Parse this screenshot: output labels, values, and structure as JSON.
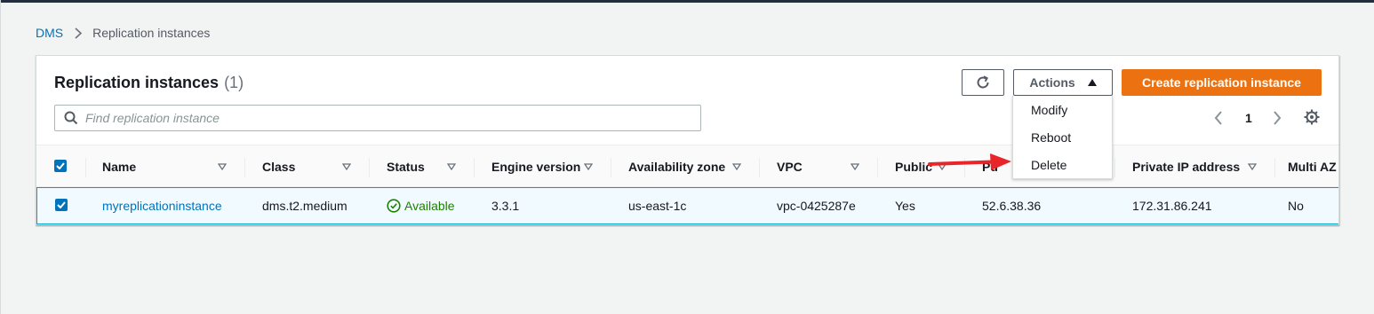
{
  "colors": {
    "link": "#0073bb",
    "primary": "#ec7211",
    "success": "#1d8102",
    "annotation_arrow": "#e8262a",
    "selected_row_bg": "#f1faff",
    "selected_row_border": "#00a1c9"
  },
  "breadcrumb": {
    "items": [
      {
        "label": "DMS",
        "link": true
      },
      {
        "label": "Replication instances",
        "link": false
      }
    ],
    "separator_icon": "chevron-right-icon"
  },
  "panel": {
    "title": "Replication instances",
    "count": "(1)",
    "search_placeholder": "Find replication instance",
    "refresh_icon": "refresh-icon",
    "actions_label": "Actions",
    "actions_icon": "caret-up-icon",
    "create_label": "Create replication instance",
    "pagination": {
      "current_page": "1"
    },
    "settings_icon": "gear-icon"
  },
  "actions_menu": {
    "items": [
      "Modify",
      "Reboot",
      "Delete"
    ]
  },
  "table": {
    "columns": [
      "Name",
      "Class",
      "Status",
      "Engine version",
      "Availability zone",
      "VPC",
      "Public",
      "Public IP address",
      "Private IP address",
      "Multi AZ"
    ],
    "visible_headers": {
      "name": "Name",
      "class": "Class",
      "status": "Status",
      "engine": "Engine version",
      "az": "Availability zone",
      "vpc": "VPC",
      "public": "Public",
      "public_ip_partial": "Pu",
      "private_ip": "Private IP address",
      "multi_az": "Multi AZ"
    },
    "rows": [
      {
        "selected": true,
        "name": "myreplicationinstance",
        "class": "dms.t2.medium",
        "status": "Available",
        "status_icon": "check-circle-icon",
        "engine_version": "3.3.1",
        "availability_zone": "us-east-1c",
        "vpc": "vpc-0425287e",
        "public": "Yes",
        "public_ip": "52.6.38.36",
        "private_ip": "172.31.86.241",
        "multi_az": "No"
      }
    ]
  },
  "annotation": {
    "type": "arrow",
    "color": "#e8262a",
    "points_to": "Delete"
  }
}
